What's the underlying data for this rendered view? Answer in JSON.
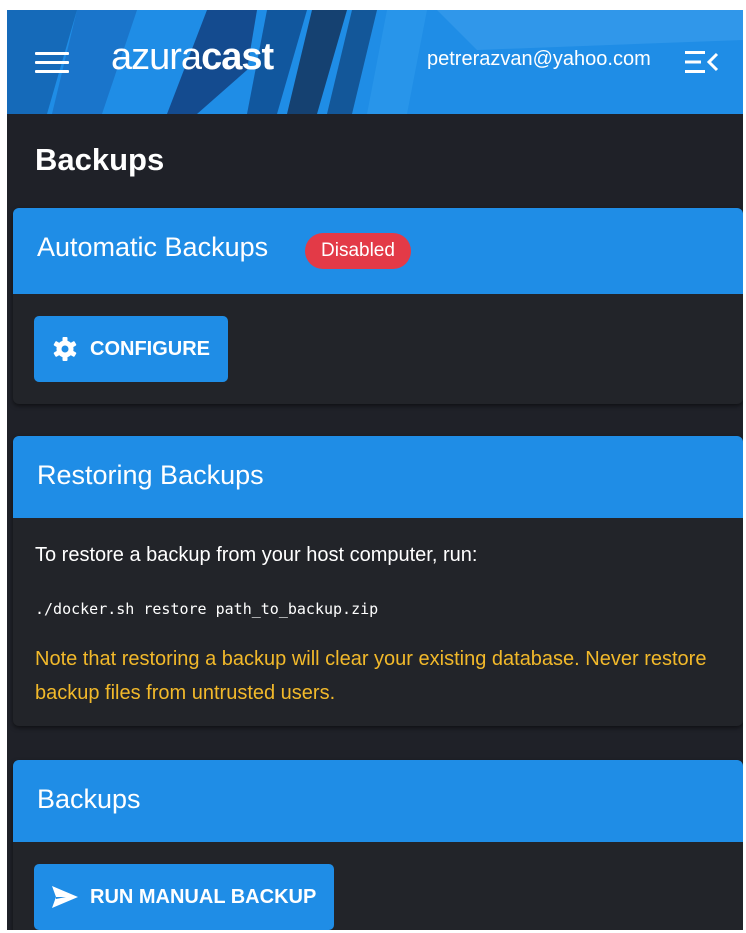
{
  "header": {
    "brand_light": "azura",
    "brand_bold": "cast",
    "user_email": "petrerazvan@yahoo.com"
  },
  "page": {
    "title": "Backups"
  },
  "automatic_backups": {
    "title": "Automatic Backups",
    "status_badge": "Disabled",
    "configure_label": "CONFIGURE"
  },
  "restoring_backups": {
    "title": "Restoring Backups",
    "instruction": "To restore a backup from your host computer, run:",
    "command": "./docker.sh restore path_to_backup.zip",
    "warning": "Note that restoring a backup will clear your existing database. Never restore backup files from untrusted users."
  },
  "backups": {
    "title": "Backups",
    "run_manual_label": "RUN MANUAL BACKUP"
  },
  "icons": {
    "menu": "hamburger-menu-icon",
    "collapse": "collapse-sidebar-icon",
    "configure": "gear-icon",
    "run": "send-icon"
  },
  "colors": {
    "primary": "#1f8de6",
    "background": "#1f2128",
    "danger": "#e33a47",
    "warning": "#f2b92a"
  }
}
